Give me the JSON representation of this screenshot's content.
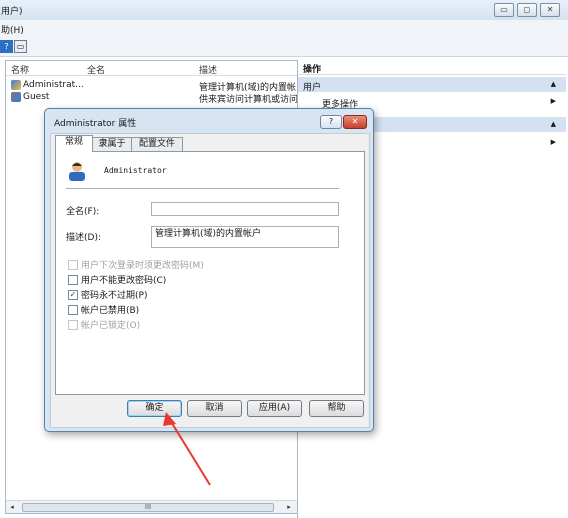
{
  "window": {
    "title": "用户)",
    "menu": "助(H)"
  },
  "toolbar": {
    "help_icon": "?"
  },
  "list": {
    "headers": [
      "名称",
      "全名",
      "描述"
    ],
    "rows": [
      {
        "name": "Administrat...",
        "fullname": "",
        "desc": "管理计算机(域)的内置帐"
      },
      {
        "name": "Guest",
        "fullname": "",
        "desc": "供来宾访问计算机或访问"
      }
    ],
    "scroll_thumb": "III"
  },
  "actions": {
    "title": "操作",
    "section_users": "用户",
    "more_actions": "更多操作"
  },
  "dialog": {
    "title": "Administrator 属性",
    "help": "?",
    "close": "✕",
    "tabs": [
      "常规",
      "隶属于",
      "配置文件"
    ],
    "username": "Administrator",
    "fullname_label": "全名(F):",
    "fullname_value": "",
    "desc_label": "描述(D):",
    "desc_value": "管理计算机(域)的内置帐户",
    "checks": [
      {
        "label": "用户下次登录时须更改密码(M)",
        "checked": false,
        "disabled": true
      },
      {
        "label": "用户不能更改密码(C)",
        "checked": false,
        "disabled": false
      },
      {
        "label": "密码永不过期(P)",
        "checked": true,
        "disabled": false
      },
      {
        "label": "帐户已禁用(B)",
        "checked": false,
        "disabled": false
      },
      {
        "label": "帐户已锁定(O)",
        "checked": false,
        "disabled": true
      }
    ],
    "buttons": {
      "ok": "确定",
      "cancel": "取消",
      "apply": "应用(A)",
      "help": "帮助"
    }
  },
  "colors": {
    "annotation_arrow": "#e8392b",
    "section_bg": "#d3e1f1"
  }
}
